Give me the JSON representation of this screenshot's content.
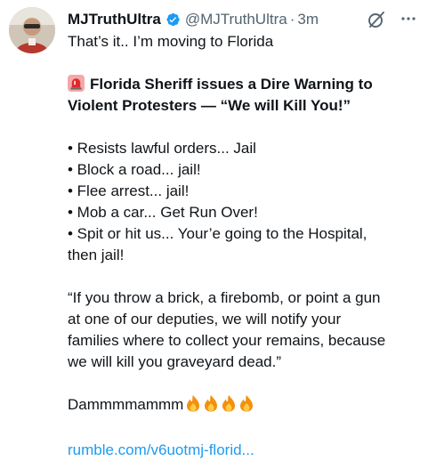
{
  "author": {
    "name": "MJTruthUltra",
    "handle": "@MJTruthUltra",
    "separator": "·",
    "time": "3m"
  },
  "icons": {
    "verified": "verified-badge-icon",
    "grok": "grok-icon",
    "more": "more-options-icon",
    "siren": "siren-emoji",
    "fire": "fire-emoji"
  },
  "colors": {
    "text": "#0f1419",
    "secondary": "#536471",
    "accent": "#1d9bf0"
  },
  "tweet": {
    "intro": "That’s it.. I’m moving to Florida",
    "headline": [
      "Florida Sheriff issues a Dire Warning to",
      "Violent Protesters — “We will Kill You!”"
    ],
    "bullets": [
      "• Resists lawful orders... Jail",
      "• Block a road... jail!",
      "• Flee arrest... jail!",
      "• Mob a car... Get Run Over!",
      "• Spit or hit us... Your’e going to the Hospital,"
    ],
    "bullet_cont": "then jail!",
    "quote": [
      "“If you throw a brick, a firebomb, or point a gun",
      "at one of our deputies, we will notify your",
      "families where to collect your remains, because",
      "we will kill you graveyard dead.”"
    ],
    "outro": "Dammmmammm",
    "link": "rumble.com/v6uotmj-florid..."
  }
}
